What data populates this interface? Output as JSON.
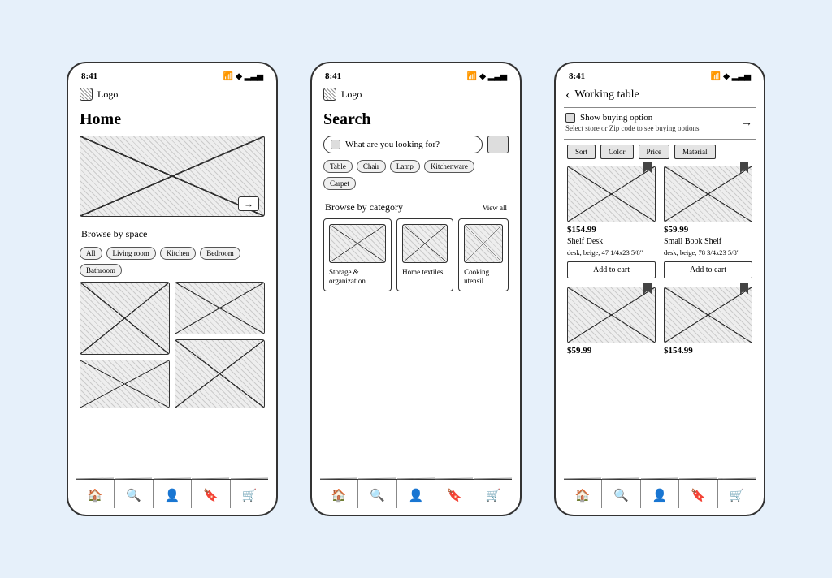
{
  "status_time": "8:41",
  "logo_label": "Logo",
  "tabbar_icons": [
    "home",
    "search",
    "user",
    "bookmark",
    "cart"
  ],
  "screen1": {
    "title": "Home",
    "browse_label": "Browse by space",
    "space_chips": [
      "All",
      "Living room",
      "Kitchen",
      "Bedroom",
      "Bathroom"
    ]
  },
  "screen2": {
    "title": "Search",
    "search_placeholder": "What are you looking for?",
    "tag_chips": [
      "Table",
      "Chair",
      "Lamp",
      "Kitchenware",
      "Carpet"
    ],
    "browse_label": "Browse by category",
    "view_all": "View all",
    "categories": [
      {
        "label": "Storage & organization"
      },
      {
        "label": "Home textiles"
      },
      {
        "label": "Cooking utensil"
      }
    ]
  },
  "screen3": {
    "title": "Working table",
    "buy_option_title": "Show buying option",
    "buy_option_sub": "Select store or Zip code to see buying options",
    "filters": [
      "Sort",
      "Color",
      "Price",
      "Material"
    ],
    "products": [
      {
        "price": "$154.99",
        "name": "Shelf Desk",
        "meta": "desk, beige, 47 1/4x23 5/8\"",
        "add": "Add to cart"
      },
      {
        "price": "$59.99",
        "name": "Small Book Shelf",
        "meta": "desk, beige, 78 3/4x23 5/8\"",
        "add": "Add to cart"
      },
      {
        "price": "$59.99",
        "name": "",
        "meta": "",
        "add": ""
      },
      {
        "price": "$154.99",
        "name": "",
        "meta": "",
        "add": ""
      }
    ]
  }
}
